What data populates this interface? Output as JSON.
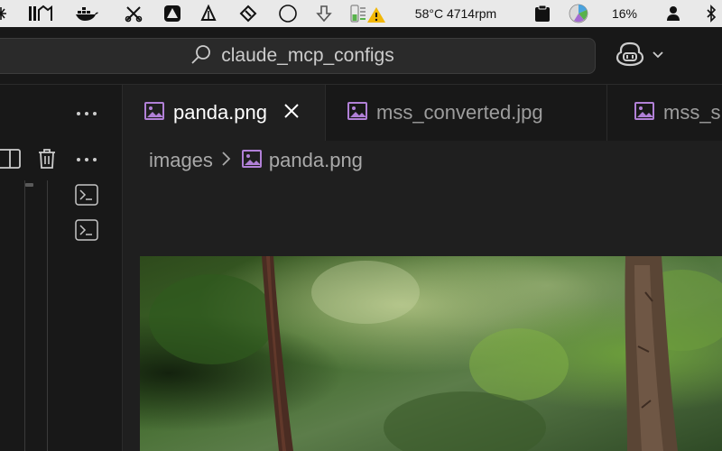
{
  "menubar": {
    "temps": "58°C 4714rpm",
    "battery": "16%"
  },
  "titlebar": {
    "search_text": "claude_mcp_configs"
  },
  "tabs": [
    {
      "label": "panda.png",
      "active": true
    },
    {
      "label": "mss_converted.jpg",
      "active": false
    },
    {
      "label": "mss_s",
      "active": false
    }
  ],
  "breadcrumb": {
    "folder": "images",
    "file": "panda.png"
  },
  "colors": {
    "image_icon": "#b180d7",
    "editor_bg": "#1f1f1f",
    "sidebar_bg": "#181818"
  }
}
